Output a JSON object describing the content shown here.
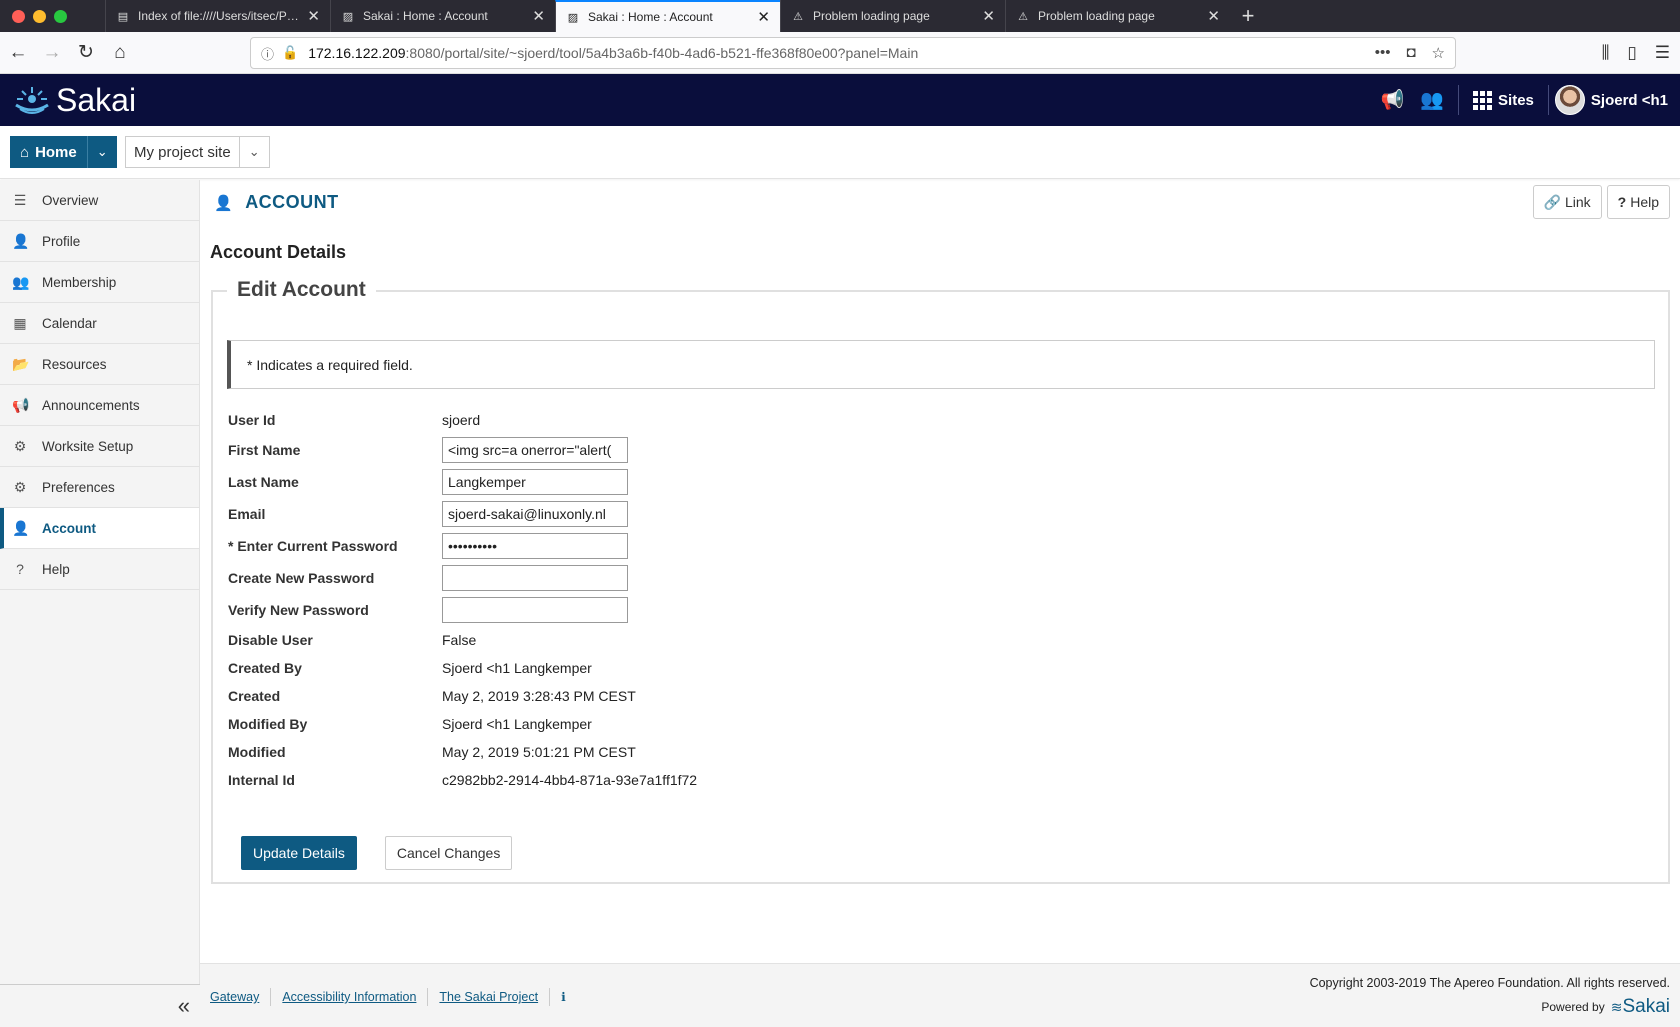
{
  "browser": {
    "tabs": [
      {
        "title": "Index of file:////Users/itsec/Proj",
        "active": false
      },
      {
        "title": "Sakai : Home : Account",
        "active": false
      },
      {
        "title": "Sakai : Home : Account",
        "active": true
      },
      {
        "title": "Problem loading page",
        "active": false
      },
      {
        "title": "Problem loading page",
        "active": false
      }
    ],
    "url_host": "172.16.122.209",
    "url_path": ":8080/portal/site/~sjoerd/tool/5a4b3a6b-f40b-4ad6-b521-ffe368f80e00?panel=Main",
    "colors": {
      "chrome": "#2b2a33",
      "accent": "#0a84ff"
    }
  },
  "header": {
    "logo_text": "Sakai",
    "sites_label": "Sites",
    "user_name": "Sjoerd <h1",
    "bg_color": "#0a0e3c"
  },
  "sitenav": {
    "home_label": "Home",
    "project_label": "My project site"
  },
  "sidebar": {
    "items": [
      {
        "label": "Overview",
        "icon": "list-icon"
      },
      {
        "label": "Profile",
        "icon": "user-icon"
      },
      {
        "label": "Membership",
        "icon": "users-icon"
      },
      {
        "label": "Calendar",
        "icon": "calendar-icon"
      },
      {
        "label": "Resources",
        "icon": "folder-open-icon"
      },
      {
        "label": "Announcements",
        "icon": "megaphone-icon"
      },
      {
        "label": "Worksite Setup",
        "icon": "gears-icon"
      },
      {
        "label": "Preferences",
        "icon": "gear-icon"
      },
      {
        "label": "Account",
        "icon": "user-icon",
        "active": true
      },
      {
        "label": "Help",
        "icon": "question-circle-icon"
      }
    ]
  },
  "main": {
    "tool_title": "ACCOUNT",
    "link_label": "Link",
    "help_label": "Help",
    "section_title": "Account Details",
    "legend": "Edit Account",
    "required_note": "* Indicates a required field.",
    "fields": {
      "user_id": {
        "label": "User Id",
        "value": "sjoerd"
      },
      "first_name": {
        "label": "First Name",
        "value": "<img src=a onerror=\"alert("
      },
      "last_name": {
        "label": "Last Name",
        "value": "Langkemper"
      },
      "email": {
        "label": "Email",
        "value": "sjoerd-sakai@linuxonly.nl"
      },
      "current_password": {
        "label": "* Enter Current Password",
        "value": "••••••••••"
      },
      "new_password": {
        "label": "Create New Password",
        "value": ""
      },
      "verify_password": {
        "label": "Verify New Password",
        "value": ""
      },
      "disable_user": {
        "label": "Disable User",
        "value": "False"
      },
      "created_by": {
        "label": "Created By",
        "value": "Sjoerd <h1 Langkemper"
      },
      "created": {
        "label": "Created",
        "value": "May 2, 2019 3:28:43 PM CEST"
      },
      "modified_by": {
        "label": "Modified By",
        "value": "Sjoerd <h1 Langkemper"
      },
      "modified": {
        "label": "Modified",
        "value": "May 2, 2019 5:01:21 PM CEST"
      },
      "internal_id": {
        "label": "Internal Id",
        "value": "c2982bb2-2914-4bb4-871a-93e7a1ff1f72"
      }
    },
    "update_label": "Update Details",
    "cancel_label": "Cancel Changes",
    "accent": "#0e5a82"
  },
  "footer": {
    "links": [
      "Gateway",
      "Accessibility Information",
      "The Sakai Project"
    ],
    "copyright": "Copyright 2003-2019 The Apereo Foundation. All rights reserved.",
    "powered_by": "Powered by",
    "powered_logo": "Sakai"
  }
}
